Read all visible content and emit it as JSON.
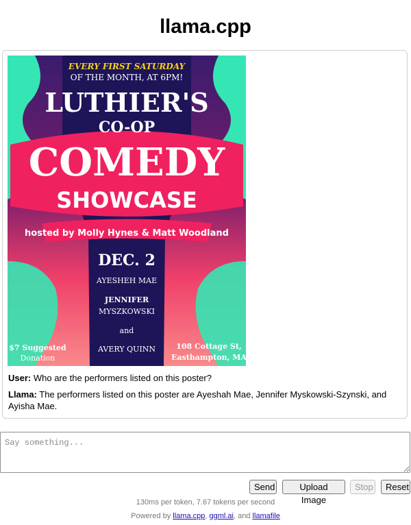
{
  "app": {
    "title": "llama.cpp"
  },
  "poster": {
    "top_line1": "EVERY FIRST SATURDAY",
    "top_line2": "OF THE MONTH, AT 6PM!",
    "name": "LUTHIER'S",
    "coop": "CO-OP",
    "comedy": "COMEDY",
    "showcase": "SHOWCASE",
    "hosted": "hosted by Molly Hynes & Matt Woodland",
    "date": "DEC. 2",
    "performer1": "AYESHEH MAE",
    "performer2a": "JENNIFER",
    "performer2b": "MYSZKOWSKI",
    "and": "and",
    "performer3": "AVERY QUINN",
    "price1": "$7 Suggested",
    "price2": "Donation",
    "addr1": "108 Cottage St,",
    "addr2": "Easthampton, MA",
    "colors": {
      "navy": "#1e1458",
      "pink": "#f0215f",
      "mint": "#35e6b4",
      "yellow": "#f7d21a",
      "coral": "#f56a77"
    }
  },
  "messages": [
    {
      "role": "User:",
      "text": " Who are the performers listed on this poster?"
    },
    {
      "role": "Llama:",
      "text": " The performers listed on this poster are Ayeshah Mae, Jennifer Myskowski-Szynski, and Ayisha Mae."
    }
  ],
  "input": {
    "placeholder": "Say something..."
  },
  "buttons": {
    "send": "Send",
    "upload": "Upload Image",
    "stop": "Stop",
    "reset": "Reset"
  },
  "stats": "130ms per token, 7.67 tokens per second",
  "footer": {
    "prefix": "Powered by ",
    "link1": "llama.cpp",
    "sep1": ", ",
    "link2": "ggml.ai",
    "sep2": ", and ",
    "link3": "llamafile"
  }
}
